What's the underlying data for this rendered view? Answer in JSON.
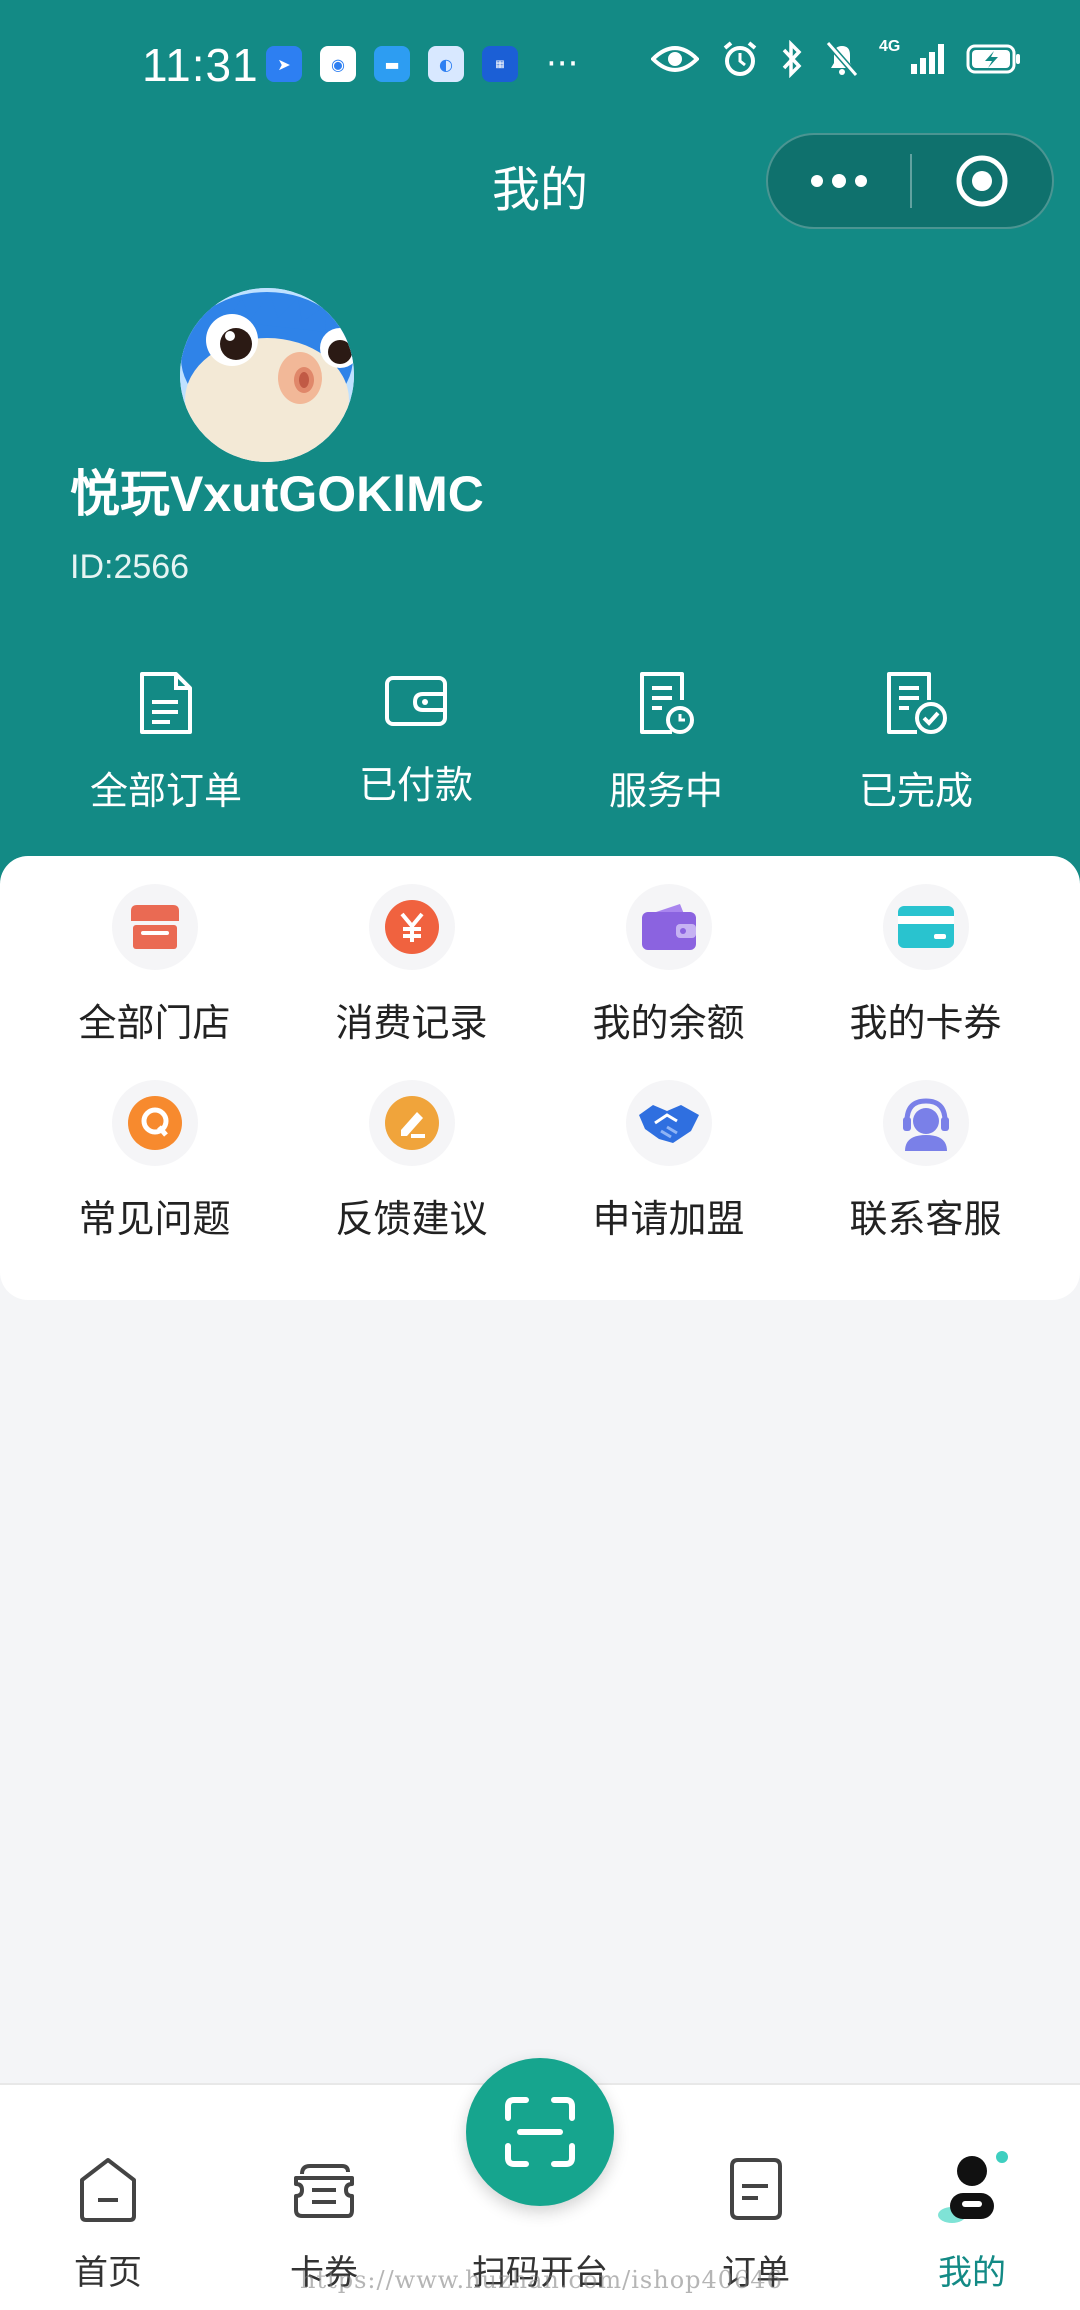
{
  "status_bar": {
    "time": "11:31",
    "notif_icons": [
      "location-app-icon",
      "shield-app-icon",
      "chat-app-icon",
      "baidu-app-icon",
      "traffic-app-icon"
    ],
    "notif_more": "···",
    "network_label": "4G"
  },
  "nav": {
    "title": "我的"
  },
  "profile": {
    "username": "悦玩VxutGOKlMC",
    "id_label": "ID:2566"
  },
  "order_status": [
    {
      "label": "全部订单",
      "icon": "document-icon"
    },
    {
      "label": "已付款",
      "icon": "wallet-icon"
    },
    {
      "label": "服务中",
      "icon": "clock-document-icon"
    },
    {
      "label": "已完成",
      "icon": "check-document-icon"
    }
  ],
  "services": [
    {
      "label": "全部门店",
      "icon": "store-icon",
      "color": "#ea6a53"
    },
    {
      "label": "消费记录",
      "icon": "yen-icon",
      "color": "#f0623f"
    },
    {
      "label": "我的余额",
      "icon": "purse-icon",
      "color": "#8b63e0"
    },
    {
      "label": "我的卡券",
      "icon": "card-icon",
      "color": "#29c3cf"
    },
    {
      "label": "常见问题",
      "icon": "question-icon",
      "color": "#f78a2e"
    },
    {
      "label": "反馈建议",
      "icon": "edit-icon",
      "color": "#f0a43b"
    },
    {
      "label": "申请加盟",
      "icon": "handshake-icon",
      "color": "#2f6fe0"
    },
    {
      "label": "联系客服",
      "icon": "headset-icon",
      "color": "#7a80e8"
    }
  ],
  "tabbar": {
    "tabs": [
      {
        "label": "首页",
        "icon": "home-icon"
      },
      {
        "label": "卡券",
        "icon": "coupon-icon"
      },
      {
        "label": "扫码开台",
        "icon": "scan-icon"
      },
      {
        "label": "订单",
        "icon": "order-icon"
      },
      {
        "label": "我的",
        "icon": "profile-icon"
      }
    ],
    "active_index": 4
  },
  "watermark": "https://www.huzhan.com/ishop40646",
  "colors": {
    "primary": "#138a85",
    "active_tab": "#138a85",
    "scan_button": "#16a58e"
  }
}
